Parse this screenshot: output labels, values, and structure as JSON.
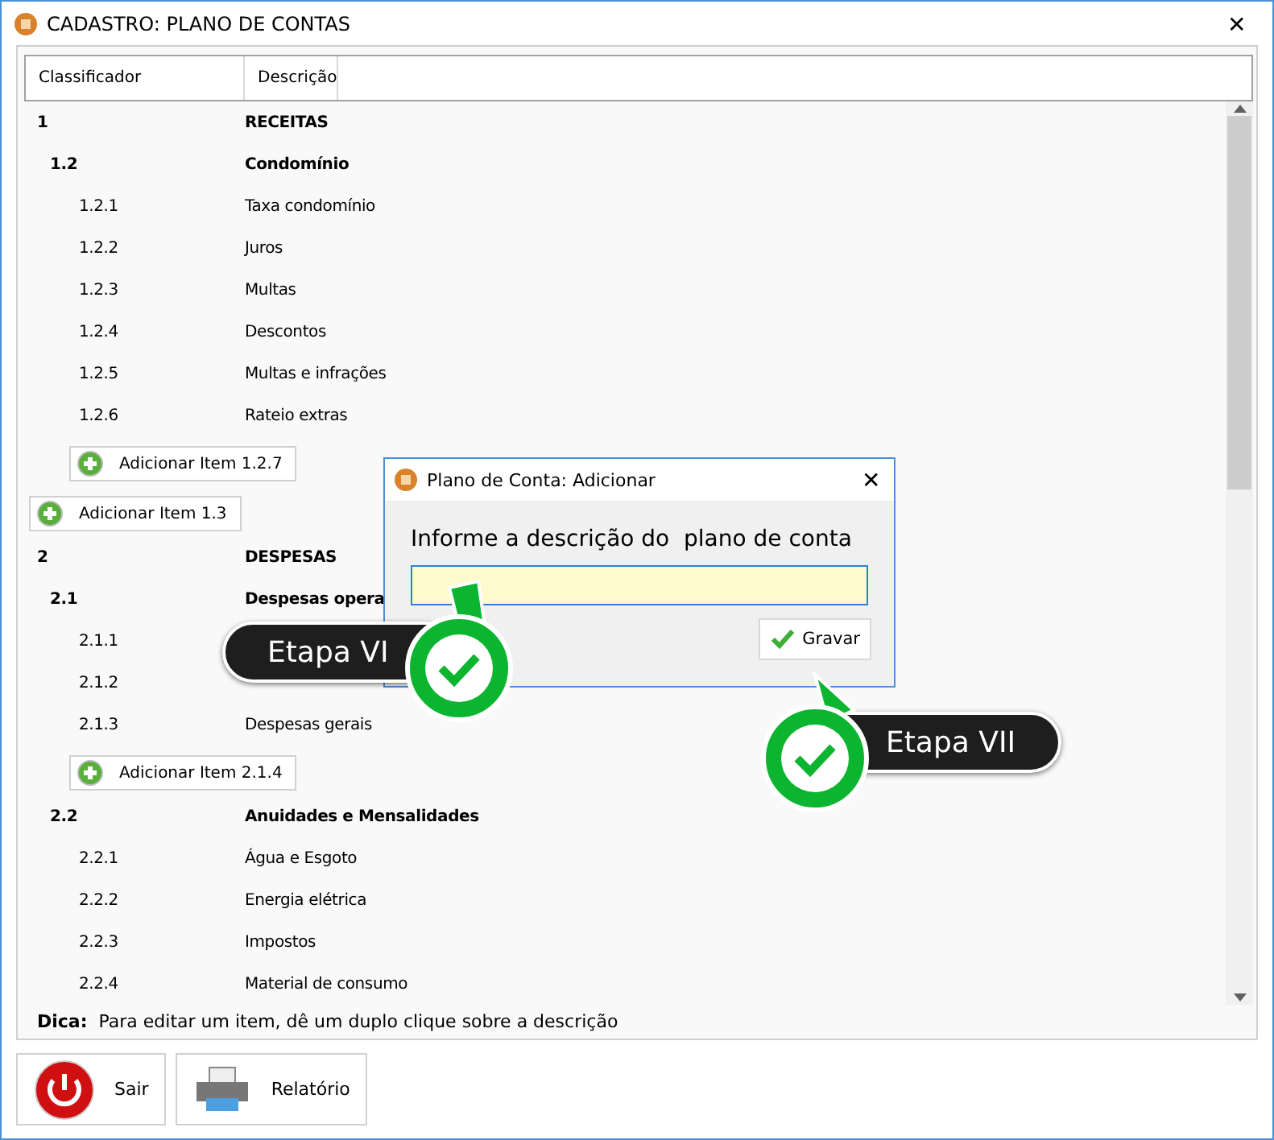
{
  "window": {
    "title": "CADASTRO: PLANO DE CONTAS",
    "close": "✕"
  },
  "table": {
    "columns": [
      "Classificador",
      "Descrição"
    ],
    "accounts": [
      {
        "code": "1",
        "description": "RECEITAS",
        "kind": "group",
        "children": [
          {
            "code": "1.2",
            "description": "Condomínio",
            "kind": "group",
            "children": [
              {
                "code": "1.2.1",
                "description": "Taxa condomínio",
                "kind": "item"
              },
              {
                "code": "1.2.2",
                "description": "Juros",
                "kind": "item"
              },
              {
                "code": "1.2.3",
                "description": "Multas",
                "kind": "item"
              },
              {
                "code": "1.2.4",
                "description": "Descontos",
                "kind": "item"
              },
              {
                "code": "1.2.5",
                "description": "Multas e infrações",
                "kind": "item"
              },
              {
                "code": "1.2.6",
                "description": "Rateio extras",
                "kind": "item"
              }
            ],
            "add_button": "Adicionar Item 1.2.7"
          }
        ],
        "add_button": "Adicionar Item 1.3"
      },
      {
        "code": "2",
        "description": "DESPESAS",
        "kind": "group",
        "children": [
          {
            "code": "2.1",
            "description": "Despesas opera",
            "kind": "group",
            "children": [
              {
                "code": "2.1.1",
                "kind": "item"
              },
              {
                "code": "2.1.2",
                "kind": "item"
              },
              {
                "code": "2.1.3",
                "description": "Despesas gerais",
                "kind": "item"
              }
            ],
            "add_button": "Adicionar Item 2.1.4"
          },
          {
            "code": "2.2",
            "description": "Anuidades e Mensalidades",
            "kind": "group",
            "children": [
              {
                "code": "2.2.1",
                "description": "Água e Esgoto",
                "kind": "item"
              },
              {
                "code": "2.2.2",
                "description": "Energia elétrica",
                "kind": "item"
              },
              {
                "code": "2.2.3",
                "description": "Impostos",
                "kind": "item"
              },
              {
                "code": "2.2.4",
                "description": "Material de consumo",
                "kind": "item"
              }
            ]
          }
        ]
      }
    ]
  },
  "tip": {
    "label": "Dica:",
    "text": "Para editar um item, dê um duplo clique sobre a descrição"
  },
  "buttons": [
    {
      "label": "Sair",
      "kind": "exit"
    },
    {
      "label": "Relatório",
      "kind": "report"
    }
  ],
  "dialog": {
    "title": "Plano de Conta: Adicionar",
    "close": "✕",
    "prompt": "Informe a descrição do  plano de conta",
    "button": "Gravar"
  },
  "steps": [
    {
      "label": "Etapa VI"
    },
    {
      "label": "Etapa VII"
    }
  ]
}
